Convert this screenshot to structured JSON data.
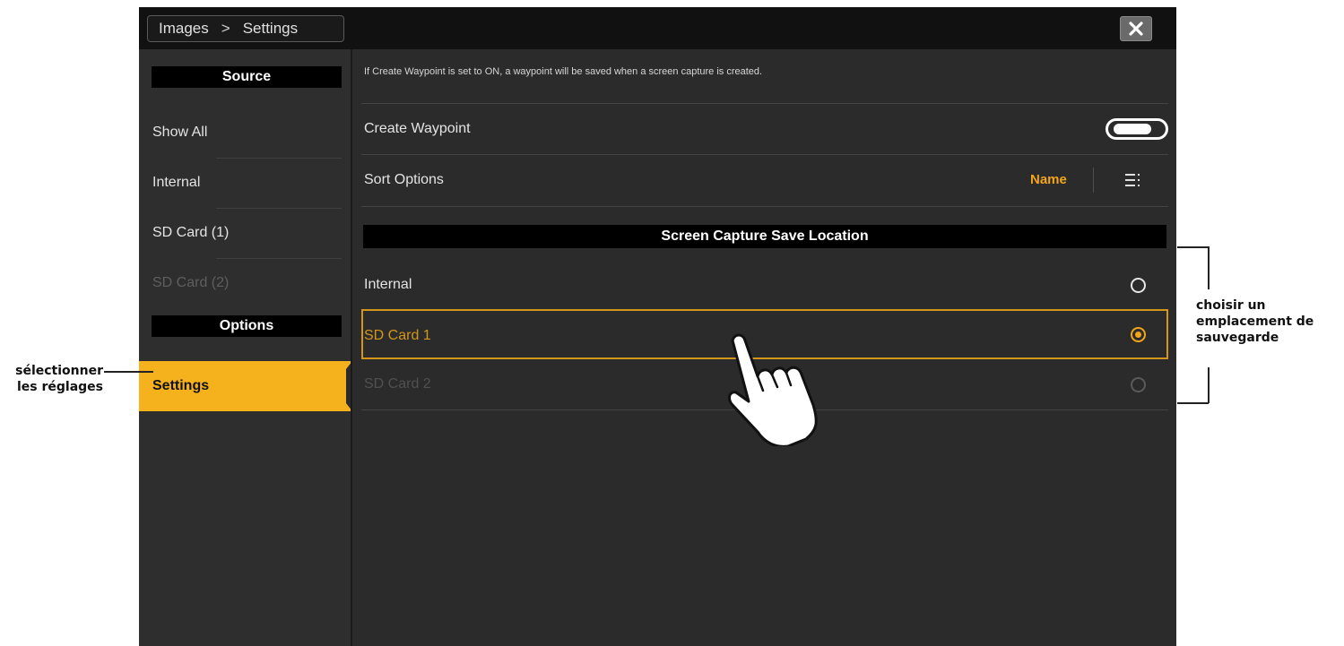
{
  "titlebar": {
    "breadcrumb_root": "Images",
    "breadcrumb_sep": ">",
    "breadcrumb_current": "Settings"
  },
  "sidebar": {
    "source_header": "Source",
    "items": [
      {
        "label": "Show All"
      },
      {
        "label": "Internal"
      },
      {
        "label": "SD Card (1)"
      },
      {
        "label": "SD Card (2)"
      }
    ],
    "options_header": "Options",
    "settings_label": "Settings"
  },
  "main": {
    "hint": "If Create Waypoint is set to ON, a waypoint will be saved when a screen capture is created.",
    "create_waypoint_label": "Create Waypoint",
    "create_waypoint_state": "ON",
    "sort_options_label": "Sort Options",
    "sort_value": "Name",
    "save_location_header": "Screen Capture Save Location",
    "locations": [
      {
        "label": "Internal",
        "selected": false
      },
      {
        "label": "SD Card 1",
        "selected": true
      },
      {
        "label": "SD Card 2",
        "selected": false
      }
    ]
  },
  "annotations": {
    "left": "sélectionner les réglages",
    "right": "choisir un emplacement de sauvegarde"
  },
  "colors": {
    "accent": "#f6b21d",
    "background": "#2b2b2b",
    "header": "#000000"
  }
}
